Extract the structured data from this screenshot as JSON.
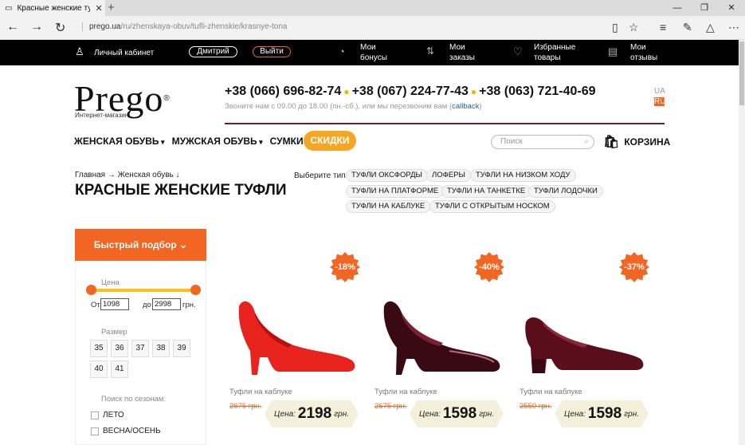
{
  "browser": {
    "tab_title": "Красные женские туфл",
    "tab_close": "✕",
    "new_tab": "+",
    "url_host": "prego.ua",
    "url_path": "/ru/zhenskaya-obuv/tufli-zhenskie/krasnye-tona"
  },
  "topbar": {
    "account": "Личный кабинет",
    "user": "Дмитрий",
    "logout": "Выйти",
    "bonuses": [
      "Мои",
      "бонусы"
    ],
    "orders": [
      "Мои",
      "заказы"
    ],
    "favorites": [
      "Избранные",
      "товары"
    ],
    "reviews": [
      "Мои",
      "отзывы"
    ]
  },
  "header": {
    "logo": "Prego",
    "logo_mark": "®",
    "logo_sub": "Интернет-магазин",
    "phones": [
      "+38 (066) 696-82-74",
      "+38 (067) 224-77-43",
      "+38 (063) 721-40-69"
    ],
    "call_hint": "Звоните нам с 09.00 до 18.00 (пн.-сб.), или мы перезвоним вам (",
    "callback": "callback",
    "call_hint_end": ")",
    "lang_ua": "UA",
    "lang_ru": "RU"
  },
  "menu": {
    "women": "ЖЕНСКАЯ ОБУВЬ",
    "men": "МУЖСКАЯ ОБУВЬ",
    "bags": "СУМКИ",
    "sale": "СКИДКИ",
    "search_placeholder": "Поиск",
    "cart": "КОРЗИНА"
  },
  "page": {
    "breadcrumb": "Главная → Женская обувь ↓",
    "title": "КРАСНЫЕ ЖЕНСКИЕ ТУФЛИ",
    "type_label": "Выберите тип:",
    "types": [
      "ТУФЛИ ОКСФОРДЫ",
      "ЛОФЕРЫ",
      "ТУФЛИ НА НИЗКОМ ХОДУ",
      "ТУФЛИ НА ПЛАТФОРМЕ",
      "ТУФЛИ НА ТАНКЕТКЕ",
      "ТУФЛИ ЛОДОЧКИ",
      "ТУФЛИ НА КАБЛУКЕ",
      "ТУФЛИ С ОТКРЫТЫМ НОСКОМ"
    ]
  },
  "filter": {
    "quick": "Быстрый подбор",
    "price_label": "Цена",
    "from_label": "От",
    "from_value": "1098",
    "to_label": "до",
    "to_value": "2998",
    "currency": "грн.",
    "size_label": "Размер",
    "sizes": [
      "35",
      "36",
      "37",
      "38",
      "39",
      "40",
      "41"
    ],
    "season_label": "Поиск по сезонам:",
    "seasons": [
      "ЛЕТО",
      "ВЕСНА/ОСЕНЬ"
    ]
  },
  "products": [
    {
      "discount": "-18%",
      "category": "Туфли на каблуке",
      "old_price": "2675 грн.",
      "price_label": "Цена:",
      "price": "2198",
      "currency": "грн.",
      "color": "#e8231e"
    },
    {
      "discount": "-40%",
      "category": "Туфли на каблуке",
      "old_price": "2675 грн.",
      "price_label": "Цена:",
      "price": "1598",
      "currency": "грн.",
      "color": "#3a0a14"
    },
    {
      "discount": "-37%",
      "category": "Туфли на каблуке",
      "old_price": "2550 грн.",
      "price_label": "Цена:",
      "price": "1598",
      "currency": "грн.",
      "color": "#5a0d1a"
    }
  ]
}
